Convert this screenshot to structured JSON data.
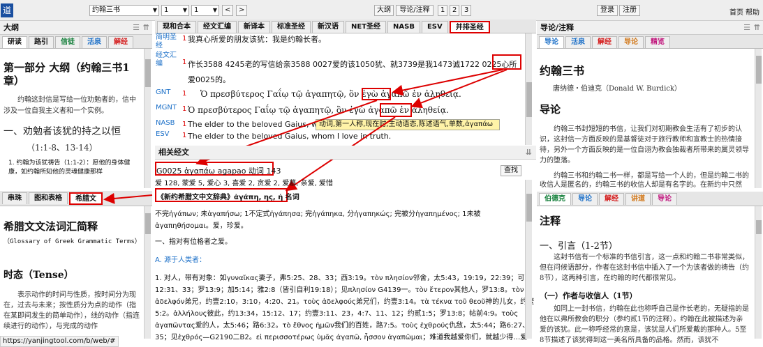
{
  "topbar": {
    "logo": "道",
    "book": "约翰三书",
    "chapter": "1",
    "verse": "1",
    "prev": "<",
    "next": ">",
    "btn_outline": "大纲",
    "btn_guide": "导论/注释",
    "p1": "1",
    "p2": "2",
    "p3": "3",
    "login": "登录",
    "register": "注册",
    "home": "首页",
    "help": "帮助"
  },
  "left_top": {
    "title": "大纲",
    "tabs": [
      "研读",
      "路引",
      "信徒",
      "活泉",
      "解经"
    ],
    "h1": "第一部分 大纲（约翰三书1章）",
    "p1": "约翰这封信是写给一位劝勉者的，信中涉及一位自我主义者和一个实例。",
    "h2": "一、劝勉者该犹的持之以恒",
    "h2sub": "（1:1-8、13-14）",
    "li": "约翰为该犹祷告（1:1-2）：愿他的身体健康，如约翰所知他的灵魂健康那样"
  },
  "left_bottom": {
    "tabs": [
      "串珠",
      "图和表格",
      "希腊文"
    ],
    "title": "希腊文文法词汇简释",
    "subtitle": "（Glossary of Greek Grammatic Terms）",
    "h2": "时态（Tense）",
    "p": "表示动作的时间与性质，按时间分为现在，过去与未来；按性质分为点的动作（指在某即间发生的简单动作），线的动作（指连续进行的动作），与完成的动作"
  },
  "middle": {
    "tabs": [
      "现和合本",
      "经文汇编",
      "新译本",
      "标准圣经",
      "新汉语",
      "NET圣经",
      "NASB",
      "ESV",
      "并排圣经"
    ],
    "verses": [
      {
        "name": "简明圣经",
        "num": "1",
        "text": "我真心所爱的朋友该犹：我是约翰长者。"
      },
      {
        "name": "经文汇编",
        "num": "1",
        "text": "作长3588 4245老的写信给亲3588 0027爱的该1050犹、就3739是我1473诚1722 0225心所爱0025的。"
      },
      {
        "name": "GNT",
        "num": "1",
        "text": "Ὁ πρεσβύτερος Γαΐῳ τῷ ἀγαπητῷ, ὃν ἐγὼ ἀγαπῶ ἐν ἀληθείᾳ."
      },
      {
        "name": "MGNT",
        "num": "1",
        "text": "Ὁ πρεσβύτερος Γαΐῳ τῷ ἀγαπητῷ, ὃν ἐγὼ ἀγαπῶ ἐν ἀληθείᾳ."
      },
      {
        "name": "NASB",
        "num": "1",
        "text": "The elder to the beloved Gaius, whom I love in truth."
      },
      {
        "name": "ESV",
        "num": "1",
        "text": "The elder to the beloved Gaius, whom I love in truth."
      }
    ],
    "tooltip": "动词,第一人称,现在时,主动语态,陈述语气,单数,ἀγαπάω",
    "related_title": "相关经文",
    "entry_head": "G0025 ἀγαπάω agapao 动词 143",
    "search_btn": "查找",
    "entry_line2": "爱 128, 蒙爱 5, 爱心 3, 喜爱 2, 贪爱 2, 爱慕, 亲爱, 爱惜",
    "dict_title": "《新约希腊文中文辞典》ἀγάπη, ης, ἡ 名词",
    "dict_lines": [
      "不完ἠγάπων; 未ἀγαπήσω; 1不定式ἠγάπησα; 完ἠγάπηκα, 分ἠγαπηκώς; 完被分ἠγαπημένος; 1未被",
      "ἀγαπηθήσομαι。爱，珍爱。",
      "一、指对有位格者之爱。",
      "A. 源于人类者：",
      "1. 对人，带有对象：如γυναῖκας妻子，弗5:25、28、33；西3:19。τὸν πλησίον邻舍，太5:43，19:19，22:39；可",
      "12:31、33；罗13:9；加5:14；雅2:8（皆引自利19:18）；见πλησίον G4139一。τὸν ἕτερον其他人，罗13:8。τὸν",
      "ἀδελφόν弟兄，约壹2:10，3:10，4:20、21。τοὺς ἀδελφούς弟兄们，约壹3:14。τὰ τέκνα τοῦ θεοῦ神的儿女，约壹",
      "5:2。ἀλλήλους彼此，约13:34，15:12、17；约壹3:11、23，4:7、11、12；约贰1:5；罗13:8；帖前4:9。τοὺς",
      "ἀγαπῶντας爱的人，太5:46；路6:32。τὸ ἔθνος ἡμῶν我们的百姓，路7:5。τοὺς ἐχθρούς仇敌，太5:44；路6:27、",
      "35；见ἐχθρός—G2190二B2。εἰ περισσοτέρως ὑμᾶς ἀγαπῶ, ἧσσον ἀγαπῶμαι；难道我越爱你们，就越少得…爱"
    ]
  },
  "right_top": {
    "title": "导论/注释",
    "tabs": [
      "导论",
      "活泉",
      "解经",
      "导论",
      "精览"
    ],
    "h1": "约翰三书",
    "author": "唐纳德・伯迪克（Donald W. Burdick）",
    "h2": "导论",
    "p1": "约翰三书封短短的书信，让我们对初期教会生活有了初步的认识，这封信一方面反映的是基督徒对于旅行教师和宣教士的热情接待，另外一个方面反映的是一位自诩为教会独裁者所带来的属灵领导力的堕落。",
    "p2": "约翰三书和约翰二书一样，都是写给一个人的，但是约翰二书的收信人是匿名的，约翰三书的收信人却是有名字的。在新约中只然"
  },
  "right_bottom": {
    "tabs": [
      "伯德克",
      "导论",
      "解经",
      "讲道",
      "导论"
    ],
    "title": "注释",
    "h2": "一、引言（1-2节）",
    "p1": "这封书信有一个标准的书信引言，这一点和约翰二书非常类似，但在问候语部分，作者在这封书信中插入了一个为该者做的祷告（约8节），这两种引言，在约翰的时代都很常见。",
    "h3": "（一）作者与收信人（1节）",
    "p2": "如同上一封书信，约翰在此也称呼自己是作长老的，无疑指的是他在以弗所教会的职分（参约贰1节的注释）。约翰在此被描述为亲爱的该犹。此一称呼经常的意是，该犹是人们所爱戴的那种人。5至8节描述了该犹得到这一美名所具备的品格。然而，该犹不"
  },
  "url": "https://yanjingtool.com/b/web/#",
  "colors": {
    "accent_red": "#d00000",
    "link_blue": "#1c70c8"
  }
}
